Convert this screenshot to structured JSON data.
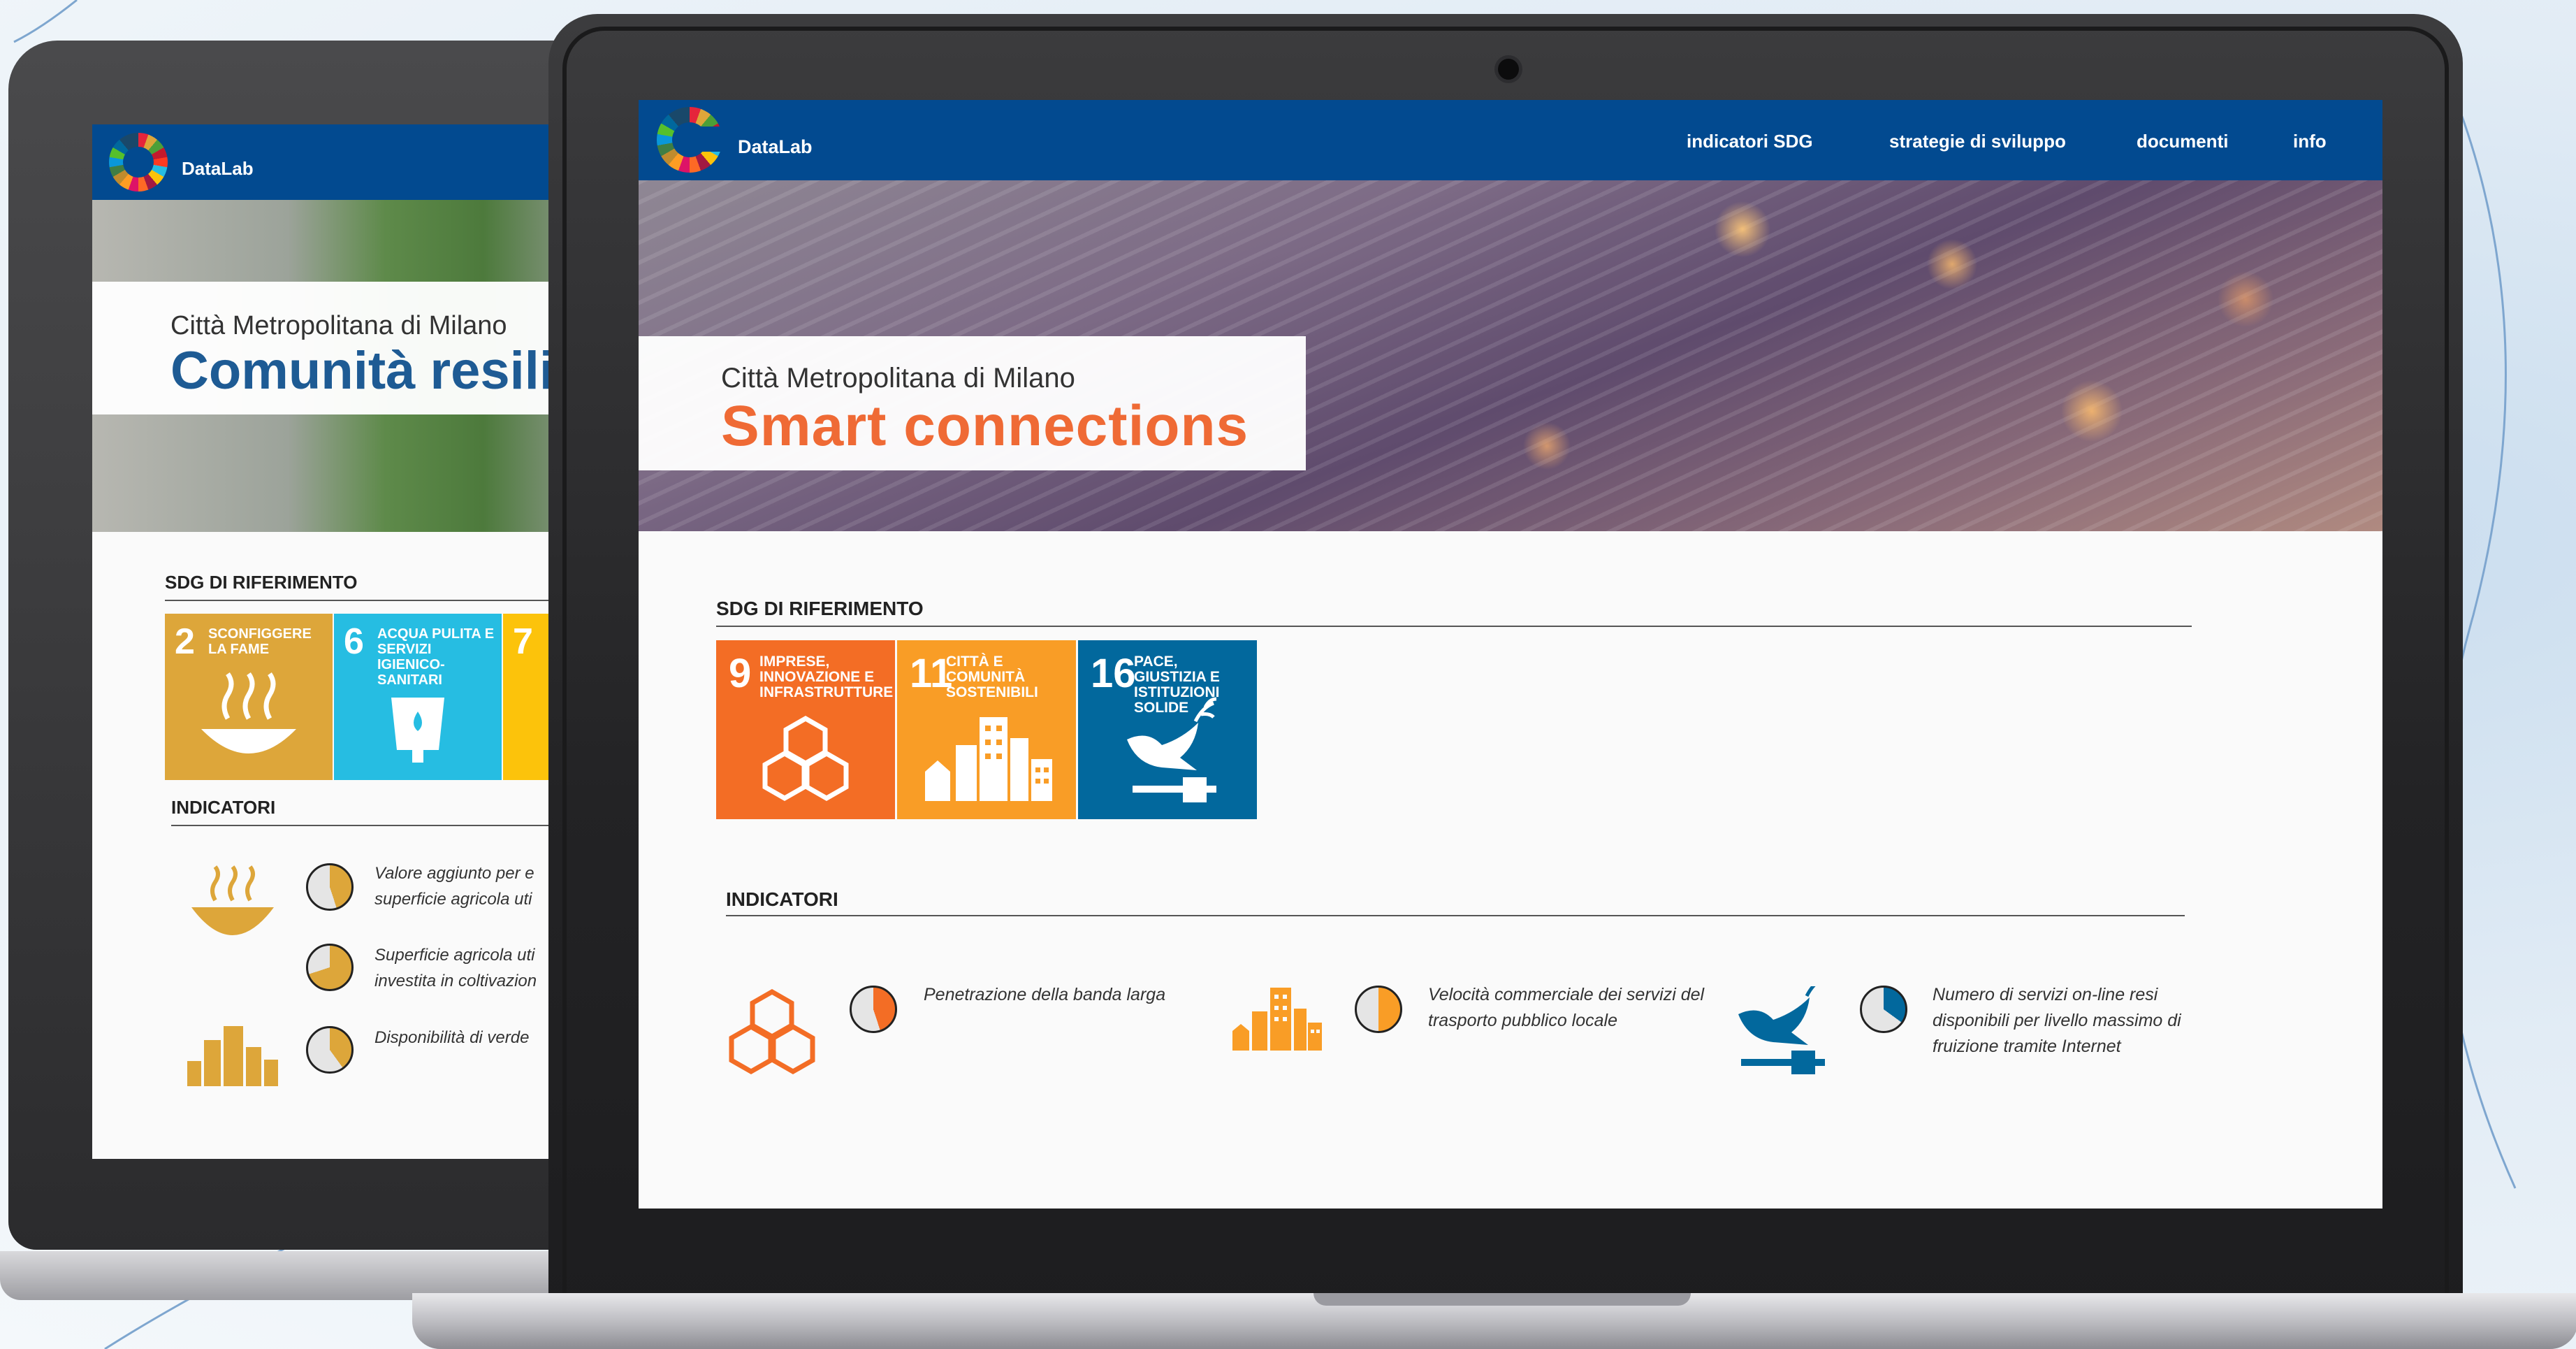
{
  "front": {
    "brand": "DataLab",
    "nav": [
      "indicatori SDG",
      "strategie di sviluppo",
      "documenti",
      "info"
    ],
    "hero_subtitle": "Città Metropolitana di Milano",
    "hero_title": "Smart connections",
    "sdg_heading": "SDG DI RIFERIMENTO",
    "sdg_tiles": [
      {
        "number": "9",
        "label": "IMPRESE, INNOVAZIONE E INFRASTRUTTURE",
        "color": "#f36d25"
      },
      {
        "number": "11",
        "label": "CITTÀ E COMUNITÀ SOSTENIBILI",
        "color": "#f99d26"
      },
      {
        "number": "16",
        "label": "PACE, GIUSTIZIA E ISTITUZIONI SOLIDE",
        "color": "#02689d"
      }
    ],
    "indicators_heading": "INDICATORI",
    "indicators": [
      {
        "text": "Penetrazione della banda larga",
        "icon": "cubes-icon",
        "pie_fraction": 0.45,
        "color": "#f36d25"
      },
      {
        "text": "Velocità commerciale dei servizi del trasporto pubblico locale",
        "icon": "city-icon",
        "pie_fraction": 0.5,
        "color": "#f99d26"
      },
      {
        "text": "Numero di servizi on-line resi disponibili per livello massimo di fruizione tramite Internet",
        "icon": "dove-gavel-icon",
        "pie_fraction": 0.35,
        "color": "#02689d"
      }
    ]
  },
  "back": {
    "brand": "DataLab",
    "hero_subtitle": "Città Metropolitana di Milano",
    "hero_title": "Comunità resili",
    "sdg_heading": "SDG DI RIFERIMENTO",
    "sdg_tiles": [
      {
        "number": "2",
        "label": "SCONFIGGERE LA FAME",
        "color": "#dda63a"
      },
      {
        "number": "6",
        "label": "ACQUA PULITA E SERVIZI IGIENICO-SANITARI",
        "color": "#26bde2"
      },
      {
        "number": "7",
        "label": "",
        "color": "#fcc30b"
      }
    ],
    "indicators_heading": "INDICATORI",
    "indicators": [
      {
        "text": "Valore aggiunto per e",
        "text2": "superficie agricola uti",
        "pie_fraction": 0.45,
        "color": "#dda63a"
      },
      {
        "text": "Superficie agricola uti",
        "text2": "investita in coltivazion",
        "pie_fraction": 0.7,
        "color": "#dda63a"
      },
      {
        "text": "Disponibilità di verde ",
        "text2": "",
        "pie_fraction": 0.4,
        "color": "#dda63a"
      }
    ]
  }
}
